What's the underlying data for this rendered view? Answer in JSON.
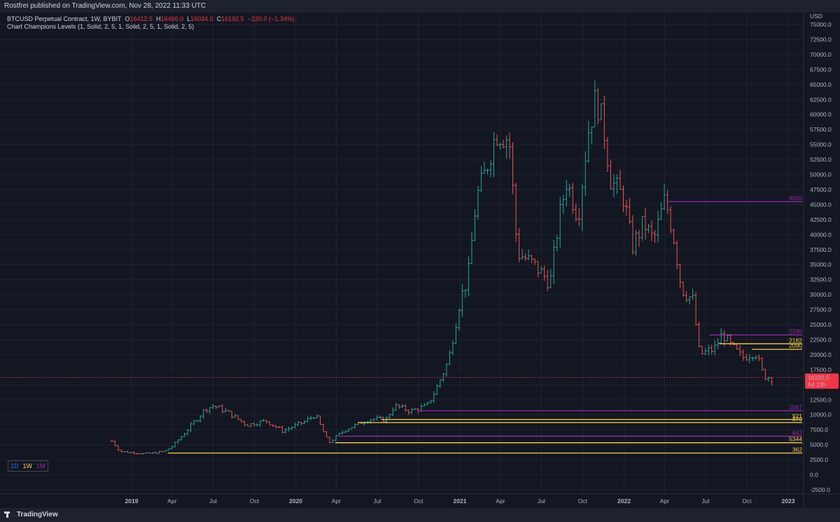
{
  "header": {
    "published": "Rostfrei published on TradingView.com, Nov 28, 2022 11:33 UTC"
  },
  "legend": {
    "symbol": "BTCUSD Perpetual Contract, 1W, BYBIT",
    "o_label": "O",
    "o": "16412.5",
    "h_label": "H",
    "h": "16466.0",
    "l_label": "L",
    "l": "16034.0",
    "c_label": "C",
    "c": "16192.5",
    "change": "−220.0 (−1.34%)",
    "indicator": "Chart Champions Levels (1, Solid, 2, 5, 1, Solid, 2, 5, 1, Solid, 2, 5)"
  },
  "footer": {
    "logo": "TradingView"
  },
  "timeframes": [
    "1D",
    "1W",
    "1M"
  ],
  "colors": {
    "bg": "#131722",
    "up": "#26a69a",
    "down": "#ef5350",
    "yellow": "#f7d046",
    "purple": "#9c27b0",
    "price": "#f23645"
  },
  "chart_data": {
    "type": "ohlc",
    "ylabel": "USD",
    "ylim": [
      -2500,
      75000
    ],
    "yticks": [
      -2500,
      0,
      2500,
      5000,
      7500,
      10000,
      12500,
      15000,
      17500,
      20000,
      22500,
      25000,
      27500,
      30000,
      32500,
      35000,
      37500,
      40000,
      42500,
      45000,
      47500,
      50000,
      52500,
      55000,
      57500,
      60000,
      62500,
      65000,
      67500,
      70000,
      72500,
      75000
    ],
    "xticks": [
      {
        "t": 2019.0,
        "label": "2019",
        "bold": true
      },
      {
        "t": 2019.247,
        "label": "Apr"
      },
      {
        "t": 2019.496,
        "label": "Jul"
      },
      {
        "t": 2019.748,
        "label": "Oct"
      },
      {
        "t": 2020.0,
        "label": "2020",
        "bold": true
      },
      {
        "t": 2020.247,
        "label": "Apr"
      },
      {
        "t": 2020.496,
        "label": "Jul"
      },
      {
        "t": 2020.748,
        "label": "Oct"
      },
      {
        "t": 2021.0,
        "label": "2021",
        "bold": true
      },
      {
        "t": 2021.247,
        "label": "Apr"
      },
      {
        "t": 2021.496,
        "label": "Jul"
      },
      {
        "t": 2021.748,
        "label": "Oct"
      },
      {
        "t": 2022.0,
        "label": "2022",
        "bold": true
      },
      {
        "t": 2022.247,
        "label": "Apr"
      },
      {
        "t": 2022.496,
        "label": "Jul"
      },
      {
        "t": 2022.748,
        "label": "Oct"
      },
      {
        "t": 2023.0,
        "label": "2023",
        "bold": true
      }
    ],
    "closes": [
      {
        "t": 2018.88,
        "c": 5600
      },
      {
        "t": 2018.93,
        "c": 3900
      },
      {
        "t": 2019.0,
        "c": 3700
      },
      {
        "t": 2019.1,
        "c": 3500
      },
      {
        "t": 2019.2,
        "c": 3900
      },
      {
        "t": 2019.25,
        "c": 4800
      },
      {
        "t": 2019.35,
        "c": 7800
      },
      {
        "t": 2019.45,
        "c": 11000
      },
      {
        "t": 2019.5,
        "c": 11500
      },
      {
        "t": 2019.58,
        "c": 10500
      },
      {
        "t": 2019.7,
        "c": 8300
      },
      {
        "t": 2019.82,
        "c": 9000
      },
      {
        "t": 2019.92,
        "c": 7300
      },
      {
        "t": 2020.05,
        "c": 8800
      },
      {
        "t": 2020.12,
        "c": 10000
      },
      {
        "t": 2020.2,
        "c": 5300
      },
      {
        "t": 2020.3,
        "c": 7500
      },
      {
        "t": 2020.45,
        "c": 9300
      },
      {
        "t": 2020.55,
        "c": 9200
      },
      {
        "t": 2020.6,
        "c": 11500
      },
      {
        "t": 2020.7,
        "c": 10600
      },
      {
        "t": 2020.8,
        "c": 11500
      },
      {
        "t": 2020.85,
        "c": 14000
      },
      {
        "t": 2020.93,
        "c": 19000
      },
      {
        "t": 2021.0,
        "c": 29000
      },
      {
        "t": 2021.05,
        "c": 33000
      },
      {
        "t": 2021.1,
        "c": 46000
      },
      {
        "t": 2021.15,
        "c": 50000
      },
      {
        "t": 2021.22,
        "c": 57000
      },
      {
        "t": 2021.3,
        "c": 56000
      },
      {
        "t": 2021.35,
        "c": 37000
      },
      {
        "t": 2021.45,
        "c": 35000
      },
      {
        "t": 2021.55,
        "c": 32000
      },
      {
        "t": 2021.6,
        "c": 42000
      },
      {
        "t": 2021.65,
        "c": 49000
      },
      {
        "t": 2021.72,
        "c": 43000
      },
      {
        "t": 2021.78,
        "c": 57000
      },
      {
        "t": 2021.83,
        "c": 63000
      },
      {
        "t": 2021.88,
        "c": 57000
      },
      {
        "t": 2021.92,
        "c": 49000
      },
      {
        "t": 2022.0,
        "c": 46000
      },
      {
        "t": 2022.05,
        "c": 38000
      },
      {
        "t": 2022.12,
        "c": 42000
      },
      {
        "t": 2022.18,
        "c": 39000
      },
      {
        "t": 2022.25,
        "c": 46000
      },
      {
        "t": 2022.3,
        "c": 40000
      },
      {
        "t": 2022.35,
        "c": 31000
      },
      {
        "t": 2022.42,
        "c": 29000
      },
      {
        "t": 2022.46,
        "c": 20000
      },
      {
        "t": 2022.55,
        "c": 21000
      },
      {
        "t": 2022.6,
        "c": 23500
      },
      {
        "t": 2022.65,
        "c": 21500
      },
      {
        "t": 2022.72,
        "c": 19500
      },
      {
        "t": 2022.8,
        "c": 20500
      },
      {
        "t": 2022.85,
        "c": 16500
      },
      {
        "t": 2022.9,
        "c": 16192.5
      }
    ],
    "levels": [
      {
        "label": "4550",
        "price": 45500,
        "from": 2022.26,
        "color": "#9c27b0"
      },
      {
        "label": "2330",
        "price": 23300,
        "from": 2022.52,
        "color": "#9c27b0"
      },
      {
        "label": "2182",
        "price": 21820,
        "from": 2022.58,
        "color": "#f7d046"
      },
      {
        "label": "2090",
        "price": 20900,
        "from": 2022.78,
        "color": "#f7d046"
      },
      {
        "label": "1067",
        "price": 10670,
        "from": 2020.75,
        "color": "#9c27b0"
      },
      {
        "label": "921",
        "price": 9210,
        "from": 2020.52,
        "color": "#f7d046"
      },
      {
        "label": "870",
        "price": 8700,
        "from": 2020.38,
        "color": "#f7d046"
      },
      {
        "label": "642",
        "price": 6420,
        "from": 2020.27,
        "color": "#9c27b0"
      },
      {
        "label": "5344",
        "price": 5344,
        "from": 2020.24,
        "color": "#f7d046"
      },
      {
        "label": "362",
        "price": 3620,
        "from": 2019.22,
        "color": "#f7d046"
      }
    ],
    "last_price": {
      "value": 16192.5,
      "label": "16192.5",
      "countdown": "6d 13h"
    }
  }
}
